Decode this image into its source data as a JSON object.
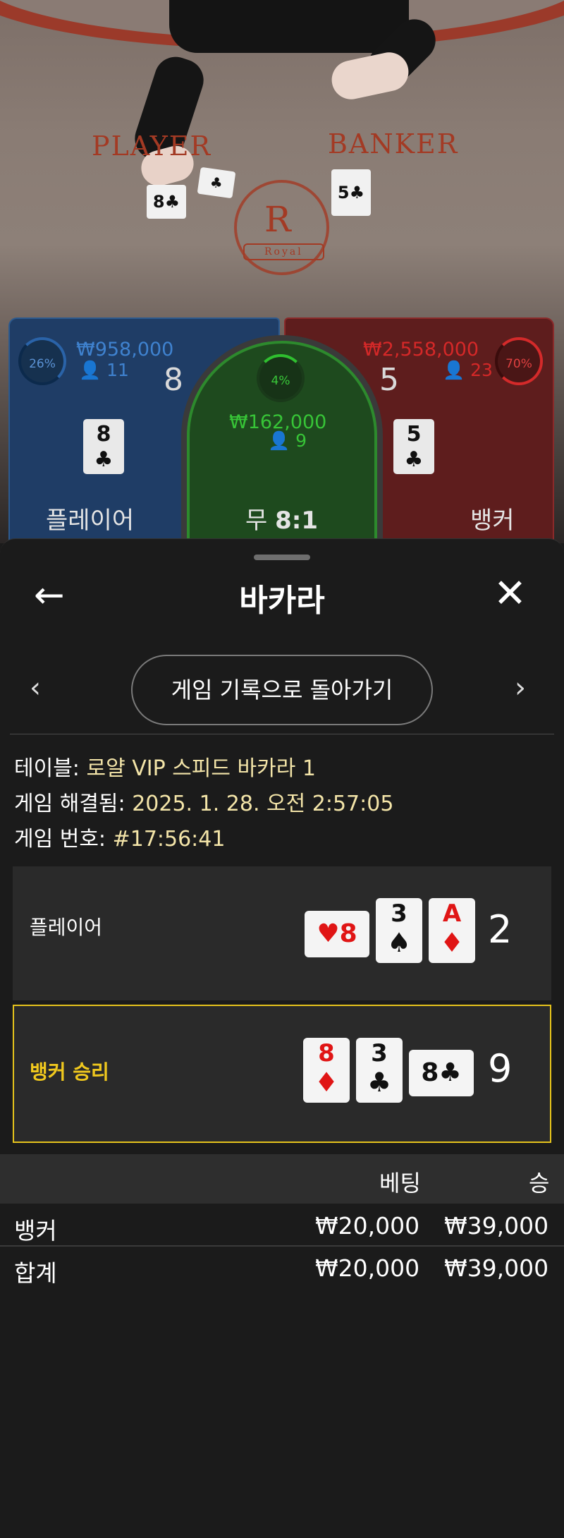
{
  "video": {
    "felt_player": "PLAYER",
    "felt_banker": "BANKER",
    "crest_letter": "R",
    "crest_text": "Royal"
  },
  "bets": {
    "player": {
      "percent": "26%",
      "amount": "₩958,000",
      "count": "11",
      "score": "8",
      "card_rank": "8",
      "card_suit": "♣",
      "label": "플레이어",
      "color": "#3f82cf"
    },
    "tie": {
      "percent": "4%",
      "amount": "₩162,000",
      "count": "9",
      "label": "무",
      "payout": "8:1",
      "color": "#37c437"
    },
    "banker": {
      "percent": "70%",
      "amount": "₩2,558,000",
      "count": "23",
      "score": "5",
      "card_rank": "5",
      "card_suit": "♣",
      "label": "뱅커",
      "color": "#d42828"
    }
  },
  "sheet": {
    "title": "바카라",
    "back_icon": "←",
    "close_icon": "✕",
    "prev_icon": "‹",
    "next_icon": "›",
    "history_button": "게임 기록으로 돌아가기",
    "table_label": "테이블:",
    "table_value": "로얄 VIP 스피드 바카라 1",
    "resolved_label": "게임 해결됨:",
    "resolved_value": "2025. 1. 28. 오전 2:57:05",
    "game_no_label": "게임 번호:",
    "game_no_value": "#17:56:41"
  },
  "hands": {
    "player": {
      "label": "플레이어",
      "total": "2",
      "cards": [
        {
          "rank": "8",
          "suit": "♥",
          "orientation": "horizontal",
          "color": "red"
        },
        {
          "rank": "3",
          "suit": "♠",
          "orientation": "vertical",
          "color": "black"
        },
        {
          "rank": "A",
          "suit": "♦",
          "orientation": "vertical",
          "color": "red"
        }
      ]
    },
    "banker": {
      "label": "뱅커 승리",
      "total": "9",
      "cards": [
        {
          "rank": "8",
          "suit": "♦",
          "orientation": "vertical",
          "color": "red"
        },
        {
          "rank": "3",
          "suit": "♣",
          "orientation": "vertical",
          "color": "black"
        },
        {
          "rank": "8",
          "suit": "♣",
          "orientation": "horizontal",
          "color": "black"
        }
      ]
    }
  },
  "bet_table": {
    "headers": {
      "bet": "베팅",
      "win": "승"
    },
    "rows": [
      {
        "name": "뱅커",
        "bet": "₩20,000",
        "win": "₩39,000"
      }
    ],
    "total": {
      "name": "합계",
      "bet": "₩20,000",
      "win": "₩39,000"
    }
  },
  "colors": {
    "winner_border": "#e6c31c",
    "info_value": "#f3e4a8"
  }
}
